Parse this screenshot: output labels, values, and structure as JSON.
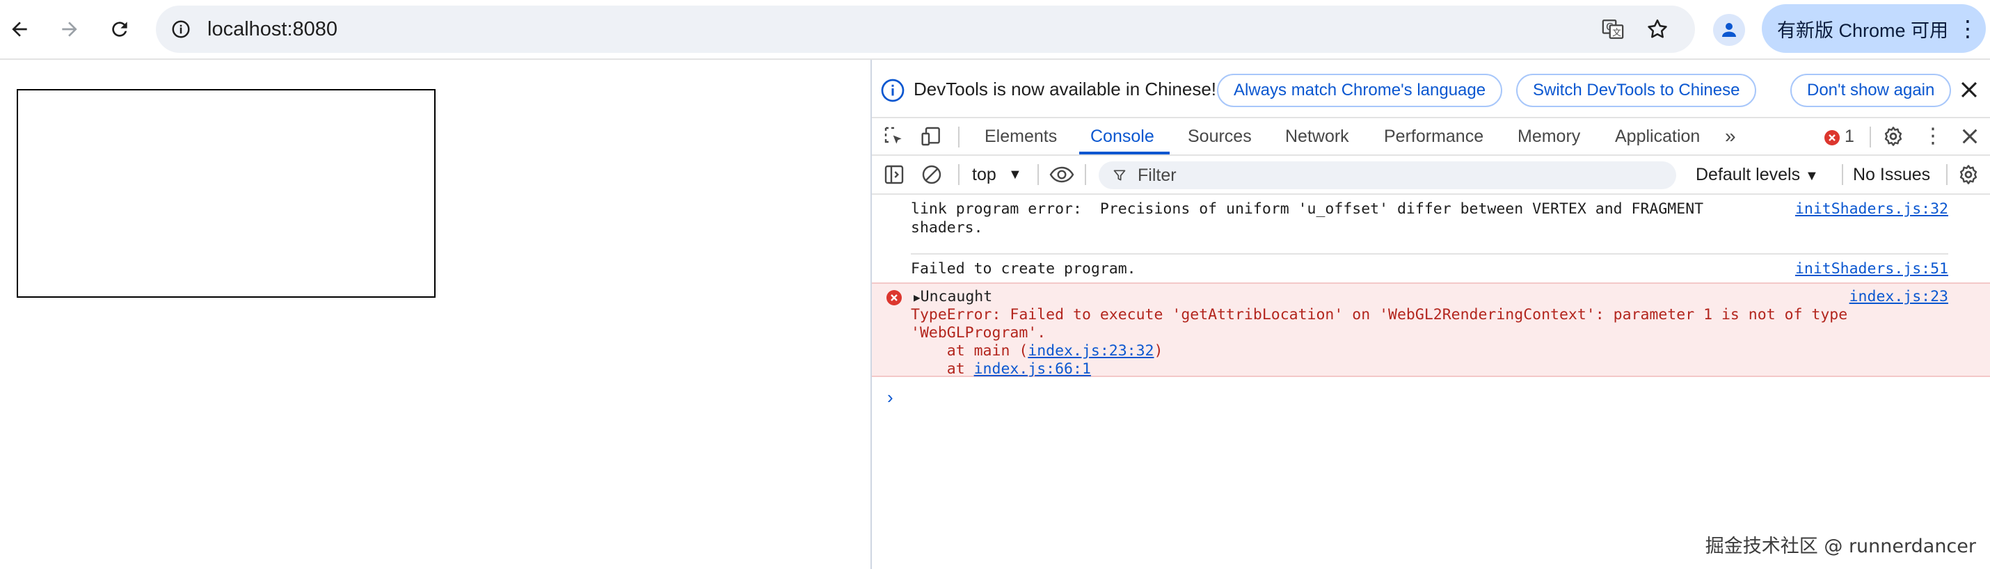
{
  "browser": {
    "url": "localhost:8080",
    "update_label": "有新版 Chrome 可用",
    "icons": [
      "back-icon",
      "forward-icon",
      "reload-icon",
      "site-info-icon",
      "translate-icon",
      "bookmark-star-icon",
      "profile-icon",
      "more-vert-icon"
    ]
  },
  "devtools": {
    "infobar": {
      "message": "DevTools is now available in Chinese!",
      "btn_match": "Always match Chrome's language",
      "btn_switch": "Switch DevTools to Chinese",
      "btn_dont_show": "Don't show again"
    },
    "tabs": [
      "Elements",
      "Console",
      "Sources",
      "Network",
      "Performance",
      "Memory",
      "Application"
    ],
    "active_tab": "Console",
    "error_count": "1",
    "filterbar": {
      "context": "top",
      "filter_placeholder": "Filter",
      "levels": "Default levels",
      "issues": "No Issues"
    },
    "messages": [
      {
        "type": "log",
        "text": "link program error:  Precisions of uniform 'u_offset' differ between VERTEX and FRAGMENT\nshaders.",
        "source": "initShaders.js:32"
      },
      {
        "type": "log",
        "text": "Failed to create program.",
        "source": "initShaders.js:51"
      },
      {
        "type": "error",
        "title": "Uncaught",
        "line1": "TypeError: Failed to execute 'getAttribLocation' on 'WebGL2RenderingContext': parameter 1 is not of type",
        "line2": "'WebGLProgram'.",
        "stack1_prefix": "    at main (",
        "stack1_link": "index.js:23:32",
        "stack1_suffix": ")",
        "stack2_prefix": "    at ",
        "stack2_link": "index.js:66:1",
        "source": "index.js:23"
      }
    ],
    "prompt": "›"
  },
  "watermark": "掘金技术社区 @ runnerdancer",
  "colors": {
    "accent": "#0b57d0",
    "error_bg": "#fcebeb",
    "error_text": "#b3261e",
    "pill_bg": "#c2dbff"
  }
}
